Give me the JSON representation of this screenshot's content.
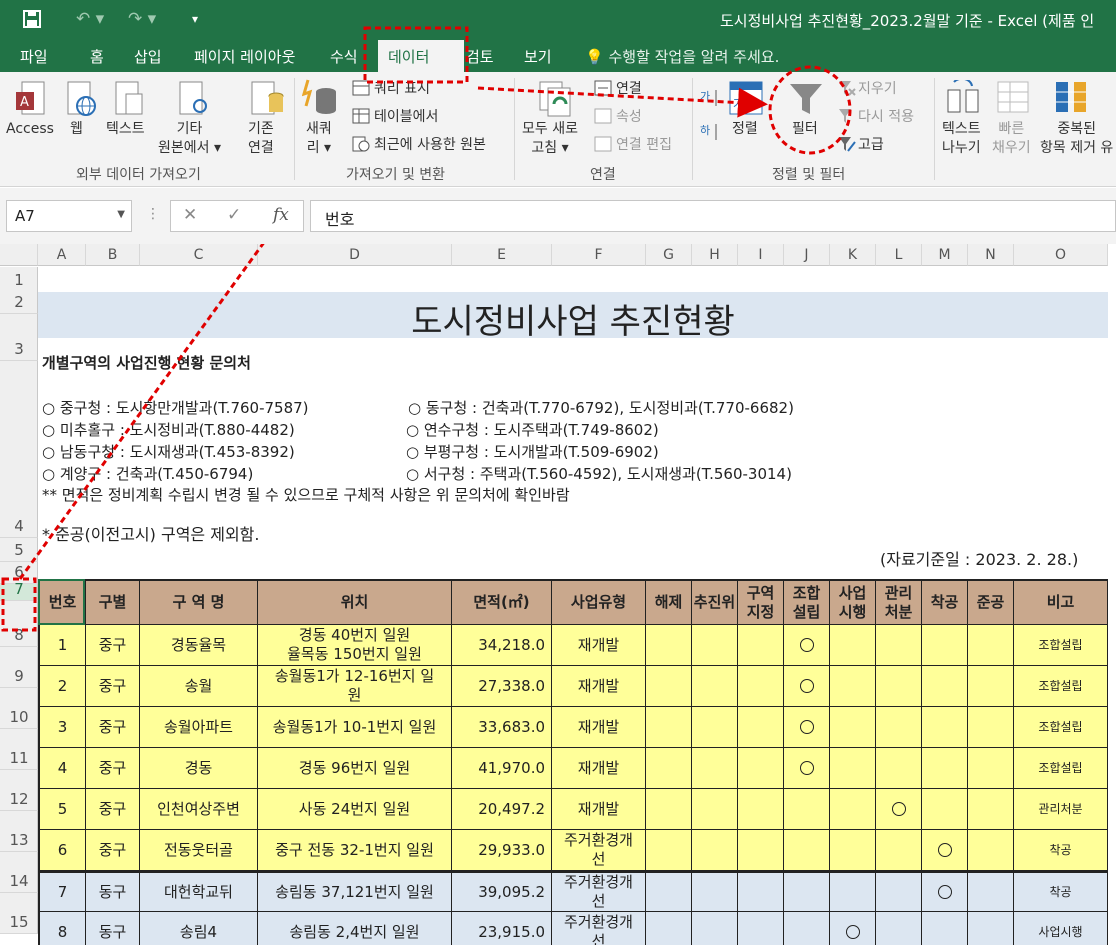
{
  "titlebar": {
    "title": "도시정비사업 추진현황_2023.2월말 기준 - Excel (제품 인"
  },
  "tabs": [
    "파일",
    "홈",
    "삽입",
    "페이지 레이아웃",
    "수식",
    "데이터",
    "검토",
    "보기"
  ],
  "tell_me": "수행할 작업을 알려 주세요.",
  "ribbon": {
    "ext": {
      "access": "Access",
      "web": "웹",
      "text": "텍스트",
      "other1": "기타",
      "other2": "원본에서",
      "group": "외부 데이터 가져오기"
    },
    "existing": [
      "기존",
      "연결"
    ],
    "newq": [
      "새쿼",
      "리"
    ],
    "get": {
      "query": "쿼리 표시",
      "table": "테이블에서",
      "recent": "최근에 사용한 원본",
      "group": "가져오기 및 변환"
    },
    "conn": {
      "refresh1": "모두 새로",
      "refresh2": "고침",
      "links": "연결",
      "props": "속성",
      "edit": "연결 편집",
      "group": "연결"
    },
    "sort": {
      "sort": "정렬",
      "filter": "필터",
      "clear": "지우기",
      "reapply": "다시 적용",
      "adv": "고급",
      "group": "정렬 및 필터"
    },
    "tools": {
      "t2c1": "텍스트",
      "t2c2": "나누기",
      "flash1": "빠른",
      "flash2": "채우기",
      "dup1": "중복된",
      "dup2": "항목 제거 유"
    }
  },
  "formula": {
    "namebox": "A7",
    "value": "번호"
  },
  "columns": [
    "A",
    "B",
    "C",
    "D",
    "E",
    "F",
    "G",
    "H",
    "I",
    "J",
    "K",
    "L",
    "M",
    "N",
    "O"
  ],
  "rows": [
    "1",
    "2",
    "3",
    "4",
    "5",
    "6",
    "7",
    "8",
    "9",
    "10",
    "11",
    "12",
    "13",
    "14",
    "15"
  ],
  "sheet": {
    "title": "도시정비사업 추진현황",
    "contact_head": "개별구역의 사업진행 현황 문의처",
    "contacts_left": [
      "○ 중구청 : 도시항만개발과(T.760-7587)",
      "○ 미추홀구 : 도시정비과(T.880-4482)",
      "○ 남동구청 : 도시재생과(T.453-8392)",
      "○ 계양구 : 건축과(T.450-6794)"
    ],
    "contacts_right": [
      "○ 동구청 : 건축과(T.770-6792), 도시정비과(T.770-6682)",
      "○ 연수구청 : 도시주택과(T.749-8602)",
      "○ 부평구청 : 도시개발과(T.509-6902)",
      "○ 서구청 : 주택과(T.560-4592), 도시재생과(T.560-3014)"
    ],
    "note1": "** 면적은 정비계획 수립시 변경 될 수 있으므로 구체적 사항은 위 문의처에 확인바람",
    "note2": "* 준공(이전고시) 구역은 제외함.",
    "date": "(자료기준일 : 2023. 2. 28.)",
    "headers": [
      "번호",
      "구별",
      "구 역 명",
      "위치",
      "면적(㎡)",
      "사업유형",
      "해제",
      "추진위",
      "구역\n지정",
      "조합\n설립",
      "사업\n시행",
      "관리\n처분",
      "착공",
      "준공",
      "비고"
    ],
    "circle": "○",
    "data_rows": [
      {
        "no": "1",
        "gu": "중구",
        "name": "경동율목",
        "loc": "경동 40번지 일원\n율목동 150번지 일원",
        "area": "34,218.0",
        "type": "재개발",
        "stage": 3,
        "note": "조합설립"
      },
      {
        "no": "2",
        "gu": "중구",
        "name": "송월",
        "loc": "송월동1가 12-16번지 일\n원",
        "area": "27,338.0",
        "type": "재개발",
        "stage": 3,
        "note": "조합설립"
      },
      {
        "no": "3",
        "gu": "중구",
        "name": "송월아파트",
        "loc": "송월동1가 10-1번지 일원",
        "area": "33,683.0",
        "type": "재개발",
        "stage": 3,
        "note": "조합설립"
      },
      {
        "no": "4",
        "gu": "중구",
        "name": "경동",
        "loc": "경동 96번지 일원",
        "area": "41,970.0",
        "type": "재개발",
        "stage": 3,
        "note": "조합설립"
      },
      {
        "no": "5",
        "gu": "중구",
        "name": "인천여상주변",
        "loc": "사동 24번지 일원",
        "area": "20,497.2",
        "type": "재개발",
        "stage": 5,
        "note": "관리처분"
      },
      {
        "no": "6",
        "gu": "중구",
        "name": "전동웃터골",
        "loc": "중구 전동 32-1번지 일원",
        "area": "29,933.0",
        "type": "주거환경개\n선",
        "stage": 6,
        "note": "착공"
      },
      {
        "no": "7",
        "gu": "동구",
        "name": "대헌학교뒤",
        "loc": "송림동 37,121번지 일원",
        "area": "39,095.2",
        "type": "주거환경개\n선",
        "stage": 6,
        "note": "착공"
      },
      {
        "no": "8",
        "gu": "동구",
        "name": "송림4",
        "loc": "송림동 2,4번지 일원",
        "area": "23,915.0",
        "type": "주거환경개\n선",
        "stage": 4,
        "note": "사업시행"
      }
    ]
  },
  "colors": {
    "excel_green": "#217346",
    "header_tan": "#c9a88d",
    "row_yellow": "#ffff99",
    "row_blue": "#dce6f1",
    "annotation_red": "#e00000"
  }
}
